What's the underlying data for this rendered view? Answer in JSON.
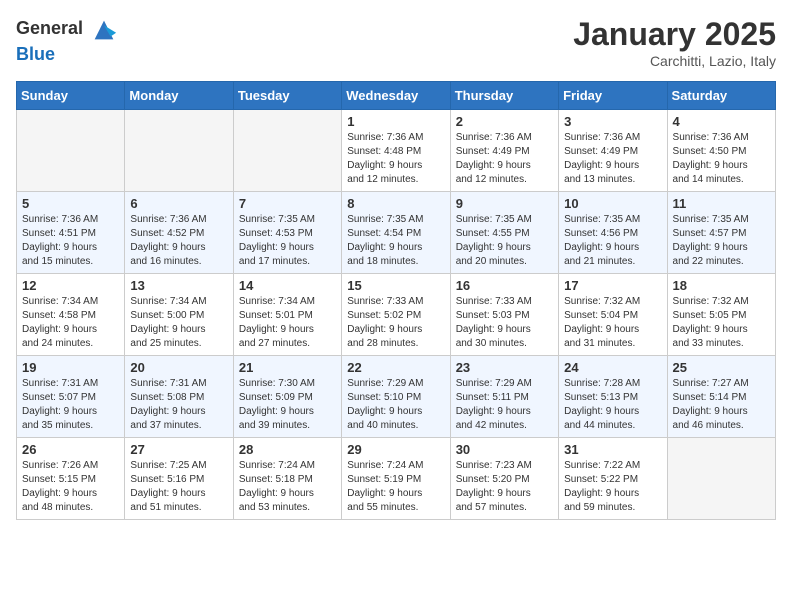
{
  "logo": {
    "text_general": "General",
    "text_blue": "Blue"
  },
  "title": "January 2025",
  "subtitle": "Carchitti, Lazio, Italy",
  "days_of_week": [
    "Sunday",
    "Monday",
    "Tuesday",
    "Wednesday",
    "Thursday",
    "Friday",
    "Saturday"
  ],
  "weeks": [
    [
      {
        "day": "",
        "info": ""
      },
      {
        "day": "",
        "info": ""
      },
      {
        "day": "",
        "info": ""
      },
      {
        "day": "1",
        "info": "Sunrise: 7:36 AM\nSunset: 4:48 PM\nDaylight: 9 hours\nand 12 minutes."
      },
      {
        "day": "2",
        "info": "Sunrise: 7:36 AM\nSunset: 4:49 PM\nDaylight: 9 hours\nand 12 minutes."
      },
      {
        "day": "3",
        "info": "Sunrise: 7:36 AM\nSunset: 4:49 PM\nDaylight: 9 hours\nand 13 minutes."
      },
      {
        "day": "4",
        "info": "Sunrise: 7:36 AM\nSunset: 4:50 PM\nDaylight: 9 hours\nand 14 minutes."
      }
    ],
    [
      {
        "day": "5",
        "info": "Sunrise: 7:36 AM\nSunset: 4:51 PM\nDaylight: 9 hours\nand 15 minutes."
      },
      {
        "day": "6",
        "info": "Sunrise: 7:36 AM\nSunset: 4:52 PM\nDaylight: 9 hours\nand 16 minutes."
      },
      {
        "day": "7",
        "info": "Sunrise: 7:35 AM\nSunset: 4:53 PM\nDaylight: 9 hours\nand 17 minutes."
      },
      {
        "day": "8",
        "info": "Sunrise: 7:35 AM\nSunset: 4:54 PM\nDaylight: 9 hours\nand 18 minutes."
      },
      {
        "day": "9",
        "info": "Sunrise: 7:35 AM\nSunset: 4:55 PM\nDaylight: 9 hours\nand 20 minutes."
      },
      {
        "day": "10",
        "info": "Sunrise: 7:35 AM\nSunset: 4:56 PM\nDaylight: 9 hours\nand 21 minutes."
      },
      {
        "day": "11",
        "info": "Sunrise: 7:35 AM\nSunset: 4:57 PM\nDaylight: 9 hours\nand 22 minutes."
      }
    ],
    [
      {
        "day": "12",
        "info": "Sunrise: 7:34 AM\nSunset: 4:58 PM\nDaylight: 9 hours\nand 24 minutes."
      },
      {
        "day": "13",
        "info": "Sunrise: 7:34 AM\nSunset: 5:00 PM\nDaylight: 9 hours\nand 25 minutes."
      },
      {
        "day": "14",
        "info": "Sunrise: 7:34 AM\nSunset: 5:01 PM\nDaylight: 9 hours\nand 27 minutes."
      },
      {
        "day": "15",
        "info": "Sunrise: 7:33 AM\nSunset: 5:02 PM\nDaylight: 9 hours\nand 28 minutes."
      },
      {
        "day": "16",
        "info": "Sunrise: 7:33 AM\nSunset: 5:03 PM\nDaylight: 9 hours\nand 30 minutes."
      },
      {
        "day": "17",
        "info": "Sunrise: 7:32 AM\nSunset: 5:04 PM\nDaylight: 9 hours\nand 31 minutes."
      },
      {
        "day": "18",
        "info": "Sunrise: 7:32 AM\nSunset: 5:05 PM\nDaylight: 9 hours\nand 33 minutes."
      }
    ],
    [
      {
        "day": "19",
        "info": "Sunrise: 7:31 AM\nSunset: 5:07 PM\nDaylight: 9 hours\nand 35 minutes."
      },
      {
        "day": "20",
        "info": "Sunrise: 7:31 AM\nSunset: 5:08 PM\nDaylight: 9 hours\nand 37 minutes."
      },
      {
        "day": "21",
        "info": "Sunrise: 7:30 AM\nSunset: 5:09 PM\nDaylight: 9 hours\nand 39 minutes."
      },
      {
        "day": "22",
        "info": "Sunrise: 7:29 AM\nSunset: 5:10 PM\nDaylight: 9 hours\nand 40 minutes."
      },
      {
        "day": "23",
        "info": "Sunrise: 7:29 AM\nSunset: 5:11 PM\nDaylight: 9 hours\nand 42 minutes."
      },
      {
        "day": "24",
        "info": "Sunrise: 7:28 AM\nSunset: 5:13 PM\nDaylight: 9 hours\nand 44 minutes."
      },
      {
        "day": "25",
        "info": "Sunrise: 7:27 AM\nSunset: 5:14 PM\nDaylight: 9 hours\nand 46 minutes."
      }
    ],
    [
      {
        "day": "26",
        "info": "Sunrise: 7:26 AM\nSunset: 5:15 PM\nDaylight: 9 hours\nand 48 minutes."
      },
      {
        "day": "27",
        "info": "Sunrise: 7:25 AM\nSunset: 5:16 PM\nDaylight: 9 hours\nand 51 minutes."
      },
      {
        "day": "28",
        "info": "Sunrise: 7:24 AM\nSunset: 5:18 PM\nDaylight: 9 hours\nand 53 minutes."
      },
      {
        "day": "29",
        "info": "Sunrise: 7:24 AM\nSunset: 5:19 PM\nDaylight: 9 hours\nand 55 minutes."
      },
      {
        "day": "30",
        "info": "Sunrise: 7:23 AM\nSunset: 5:20 PM\nDaylight: 9 hours\nand 57 minutes."
      },
      {
        "day": "31",
        "info": "Sunrise: 7:22 AM\nSunset: 5:22 PM\nDaylight: 9 hours\nand 59 minutes."
      },
      {
        "day": "",
        "info": ""
      }
    ]
  ]
}
